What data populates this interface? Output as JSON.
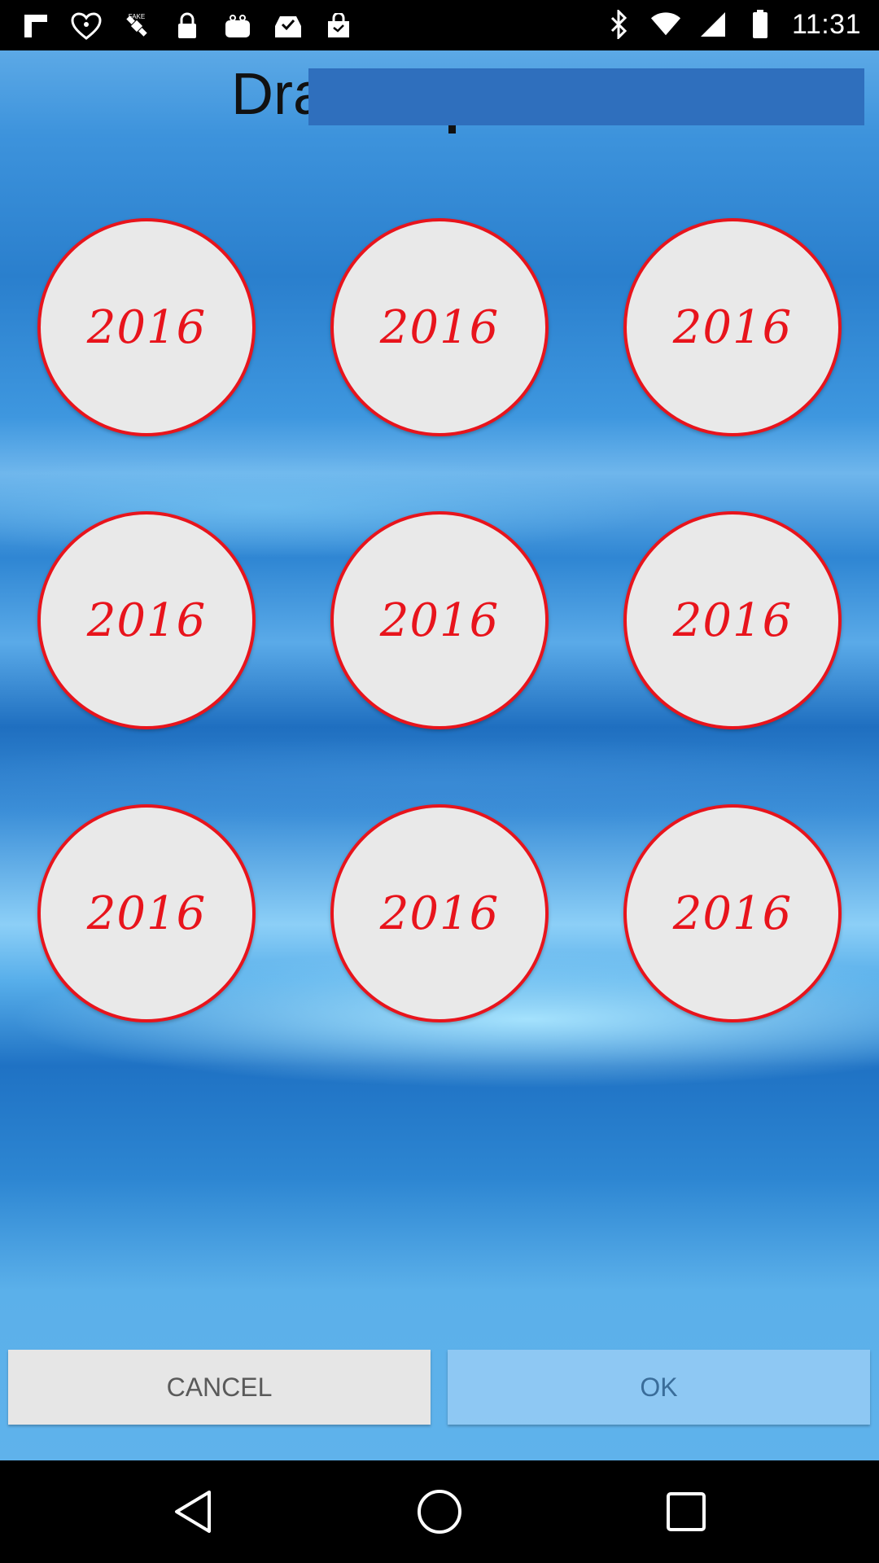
{
  "status_bar": {
    "time": "11:31",
    "left_icons": [
      "flipboard-icon",
      "iheartradio-icon",
      "fake-gps-icon",
      "lock-icon",
      "shopping-bag-icon",
      "inbox-check-icon",
      "shopping-bag-icon"
    ],
    "right_icons": [
      "bluetooth-icon",
      "wifi-icon",
      "signal-icon",
      "battery-icon"
    ]
  },
  "title": {
    "visible_text": "Dra"
  },
  "coins": [
    {
      "label": "2016"
    },
    {
      "label": "2016"
    },
    {
      "label": "2016"
    },
    {
      "label": "2016"
    },
    {
      "label": "2016"
    },
    {
      "label": "2016"
    },
    {
      "label": "2016"
    },
    {
      "label": "2016"
    },
    {
      "label": "2016"
    }
  ],
  "buttons": {
    "cancel_label": "CANCEL",
    "ok_label": "OK"
  },
  "nav_bar": {
    "icons": [
      "back-icon",
      "home-icon",
      "recents-icon"
    ]
  },
  "colors": {
    "coin_red": "#e8141c",
    "coin_fill": "#e9e9e9",
    "title_overlay": "#2f6fbd"
  }
}
